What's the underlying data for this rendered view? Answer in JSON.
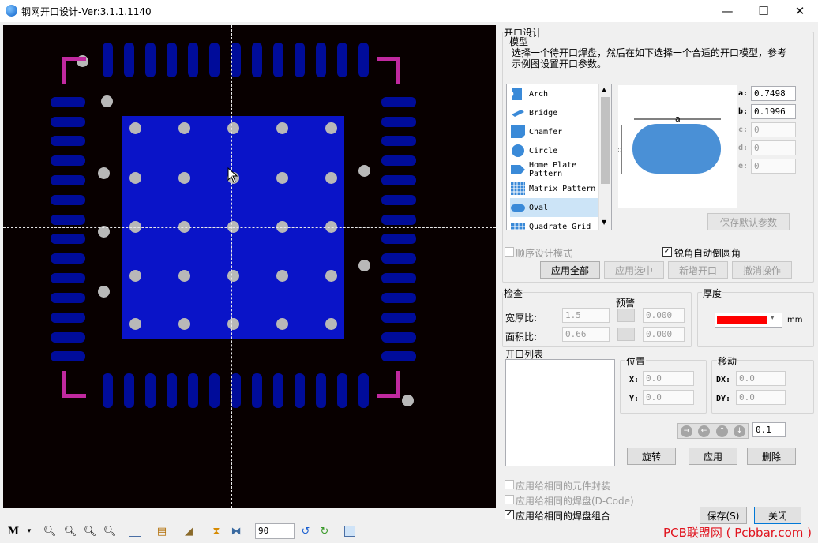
{
  "window": {
    "title": "钢网开口设计-Ver:3.1.1.1140",
    "minimize": "—",
    "maximize": "☐",
    "close": "✕"
  },
  "design": {
    "group_title": "开口设计",
    "model_title": "模型",
    "instructions": "选择一个待开口焊盘，然后在如下选择一个合适的开口模型，参考示例图设置开口参数。",
    "models": [
      "Arch",
      "Bridge",
      "Chamfer",
      "Circle",
      "Home Plate Pattern",
      "Matrix Pattern",
      "Oval",
      "Quadrate Grid"
    ],
    "selected_model": "Oval",
    "preview": {
      "a_label": "a",
      "b_label": "b"
    },
    "params": [
      {
        "label": "a:",
        "value": "0.7498",
        "enabled": true
      },
      {
        "label": "b:",
        "value": "0.1996",
        "enabled": true
      },
      {
        "label": "c:",
        "value": "0",
        "enabled": false
      },
      {
        "label": "d:",
        "value": "0",
        "enabled": false
      },
      {
        "label": "e:",
        "value": "0",
        "enabled": false
      }
    ],
    "save_default": "保存默认参数",
    "sequential_mode": "顺序设计模式",
    "auto_round": "锐角自动倒圆角",
    "apply_all": "应用全部",
    "apply_selected": "应用选中",
    "add_opening": "新增开口",
    "undo": "撤消操作"
  },
  "check": {
    "title": "检查",
    "warning": "预警",
    "rows": [
      {
        "label": "宽厚比:",
        "value": "1.5",
        "warn": "0.000"
      },
      {
        "label": "面积比:",
        "value": "0.66",
        "warn": "0.000"
      }
    ]
  },
  "thickness": {
    "title": "厚度",
    "unit": "mm",
    "color": "#ff0000"
  },
  "openings": {
    "title": "开口列表",
    "position": {
      "title": "位置",
      "x_label": "X:",
      "x": "0.0",
      "y_label": "Y:",
      "y": "0.0"
    },
    "move": {
      "title": "移动",
      "dx_label": "DX:",
      "dx": "0.0",
      "dy_label": "DY:",
      "dy": "0.0"
    },
    "step": "0.1",
    "rotate": "旋转",
    "apply": "应用",
    "delete": "删除"
  },
  "footer": {
    "apply_same_package": "应用给相同的元件封装",
    "apply_same_pad": "应用给相同的焊盘(D-Code)",
    "apply_same_group": "应用给相同的焊盘组合",
    "save": "保存(S)",
    "close": "关闭"
  },
  "toolbar": {
    "rotation": "90",
    "menu_glyph": "M"
  },
  "watermark": "PCB联盟网 ( Pcbbar.com )",
  "colors": {
    "pad": "#000c9a",
    "thermal": "#0a14c8",
    "marker": "#c0299f",
    "canvas_bg": "#080000"
  }
}
